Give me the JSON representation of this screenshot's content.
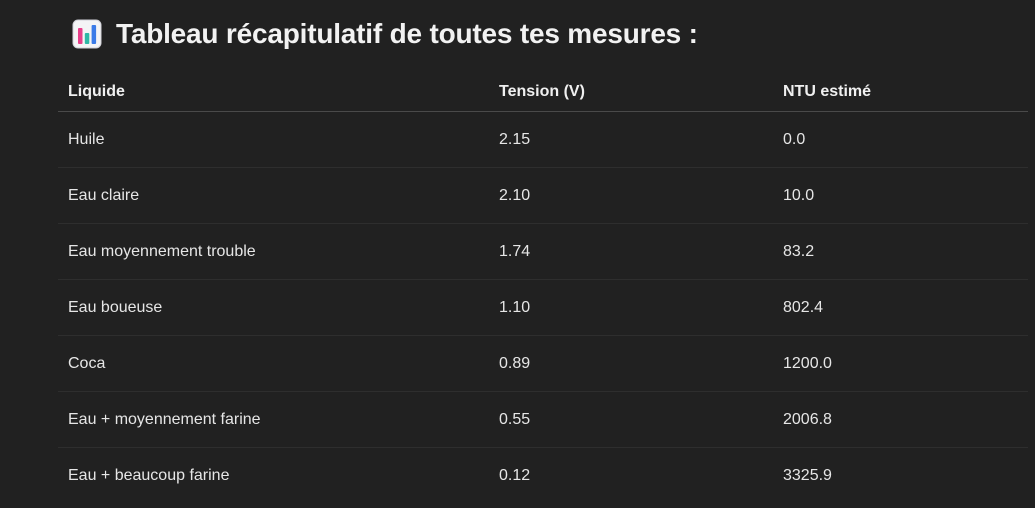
{
  "heading": {
    "icon": "bar-chart-emoji-icon",
    "text": "Tableau récapitulatif de toutes tes mesures :"
  },
  "table": {
    "headers": [
      "Liquide",
      "Tension (V)",
      "NTU estimé"
    ],
    "rows": [
      [
        "Huile",
        "2.15",
        "0.0"
      ],
      [
        "Eau claire",
        "2.10",
        "10.0"
      ],
      [
        "Eau moyennement trouble",
        "1.74",
        "83.2"
      ],
      [
        "Eau boueuse",
        "1.10",
        "802.4"
      ],
      [
        "Coca",
        "0.89",
        "1200.0"
      ],
      [
        "Eau + moyennement farine",
        "0.55",
        "2006.8"
      ],
      [
        "Eau + beaucoup farine",
        "0.12",
        "3325.9"
      ]
    ]
  },
  "colors": {
    "background": "#212121",
    "text": "#ececec",
    "header_rule": "#4a4a4a",
    "row_rule": "#2e2e2e"
  }
}
